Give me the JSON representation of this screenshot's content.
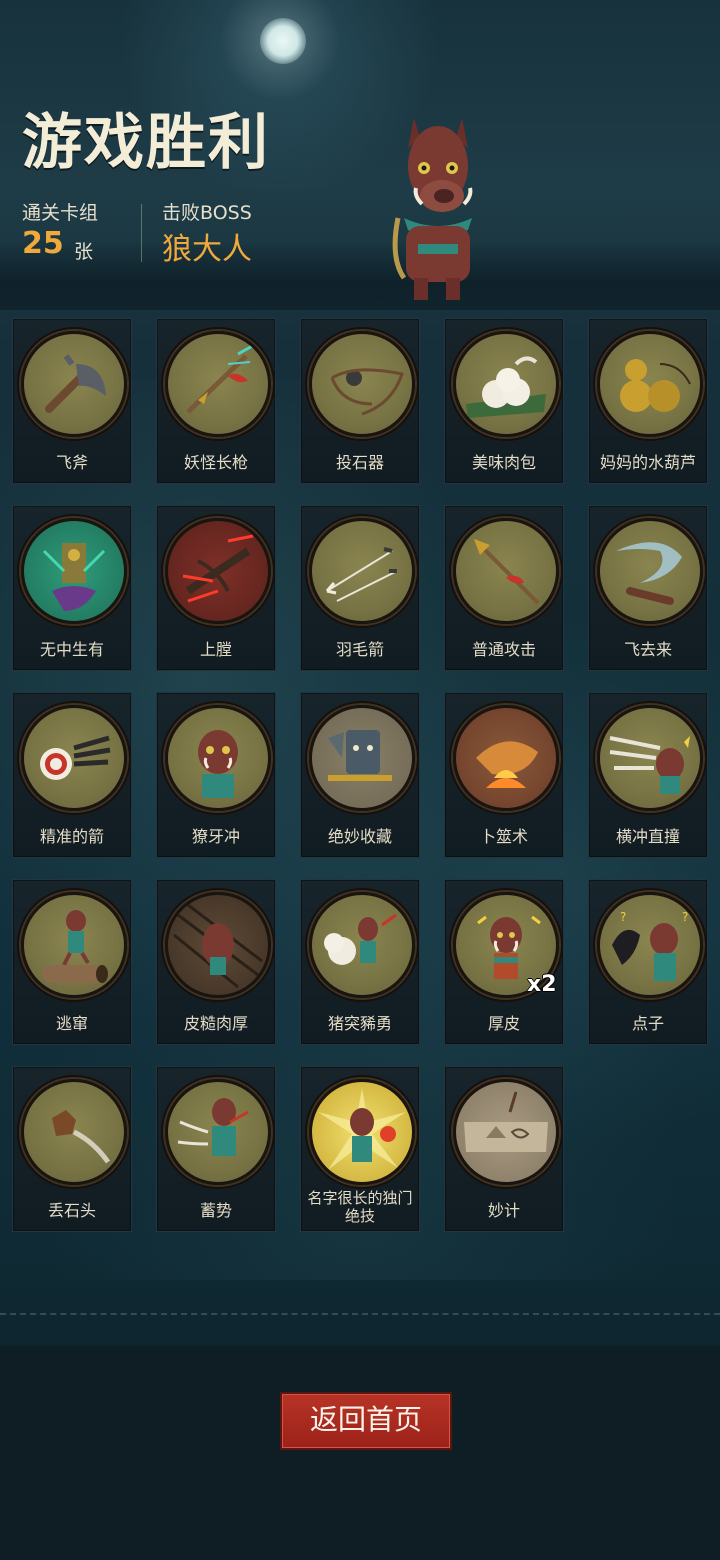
{
  "header": {
    "title": "游戏胜利",
    "deck_label": "通关卡组",
    "deck_count": "25",
    "deck_unit": "张",
    "boss_label": "击败BOSS",
    "boss_name": "狼大人"
  },
  "cards": [
    {
      "name": "飞斧",
      "icon": "axe-icon"
    },
    {
      "name": "妖怪长枪",
      "icon": "spear-icon"
    },
    {
      "name": "投石器",
      "icon": "sling-icon"
    },
    {
      "name": "美味肉包",
      "icon": "meat-bun-icon"
    },
    {
      "name": "妈妈的水葫芦",
      "icon": "gourd-icon"
    },
    {
      "name": "无中生有",
      "icon": "summon-icon"
    },
    {
      "name": "上膛",
      "icon": "crossbow-icon"
    },
    {
      "name": "羽毛箭",
      "icon": "arrows-icon"
    },
    {
      "name": "普通攻击",
      "icon": "spear-attack-icon"
    },
    {
      "name": "飞去来",
      "icon": "boomerang-icon"
    },
    {
      "name": "精准的箭",
      "icon": "target-icon"
    },
    {
      "name": "獠牙冲",
      "icon": "boar-charge-icon"
    },
    {
      "name": "绝妙收藏",
      "icon": "treasure-icon"
    },
    {
      "name": "卜筮术",
      "icon": "divination-icon"
    },
    {
      "name": "横冲直撞",
      "icon": "rampage-icon"
    },
    {
      "name": "逃窜",
      "icon": "flee-icon"
    },
    {
      "name": "皮糙肉厚",
      "icon": "tough-skin-icon"
    },
    {
      "name": "猪突豨勇",
      "icon": "boar-rush-icon"
    },
    {
      "name": "厚皮",
      "icon": "thick-hide-icon",
      "badge": "x2"
    },
    {
      "name": "点子",
      "icon": "idea-icon"
    },
    {
      "name": "丢石头",
      "icon": "rock-icon"
    },
    {
      "name": "蓄势",
      "icon": "charge-up-icon"
    },
    {
      "name": "名字很长的独门绝技",
      "icon": "special-move-icon",
      "line1": "名字很长的独门",
      "line2": "绝技"
    },
    {
      "name": "妙计",
      "icon": "scheme-icon"
    }
  ],
  "footer": {
    "home_button": "返回首页"
  },
  "colors": {
    "accent": "#f2a93b",
    "button": "#b73326"
  }
}
